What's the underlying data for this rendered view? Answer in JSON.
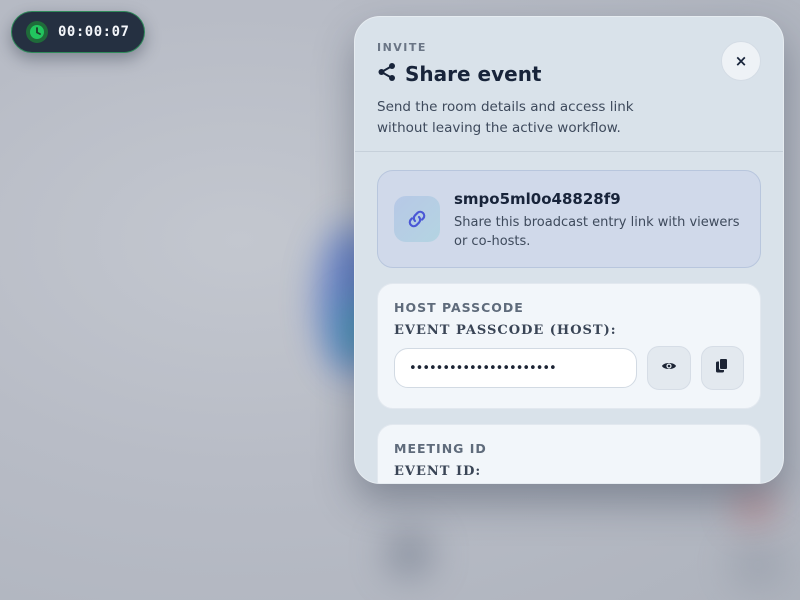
{
  "timer": {
    "elapsed": "00:00:07",
    "icon": "clock-icon"
  },
  "modal": {
    "kicker": "INVITE",
    "title": "Share event",
    "title_icon": "share-icon",
    "subtitle": "Send the room details and access link without leaving the active workflow.",
    "close_label": "×"
  },
  "link_card": {
    "icon": "link-icon",
    "event_code": "smpo5ml0o48828f9",
    "description": "Share this broadcast entry link with viewers or co-hosts."
  },
  "host_passcode": {
    "section_label": "HOST PASSCODE",
    "field_label": "EVENT PASSCODE (HOST):",
    "masked_value": "••••••••••••••••••••••",
    "reveal_icon": "eye-icon",
    "copy_icon": "copy-icon"
  },
  "meeting_id": {
    "section_label": "MEETING ID",
    "field_label": "EVENT ID:"
  },
  "colors": {
    "accent": "#4a57d6",
    "timer_green": "#22c55e",
    "title_text": "#18243a"
  }
}
